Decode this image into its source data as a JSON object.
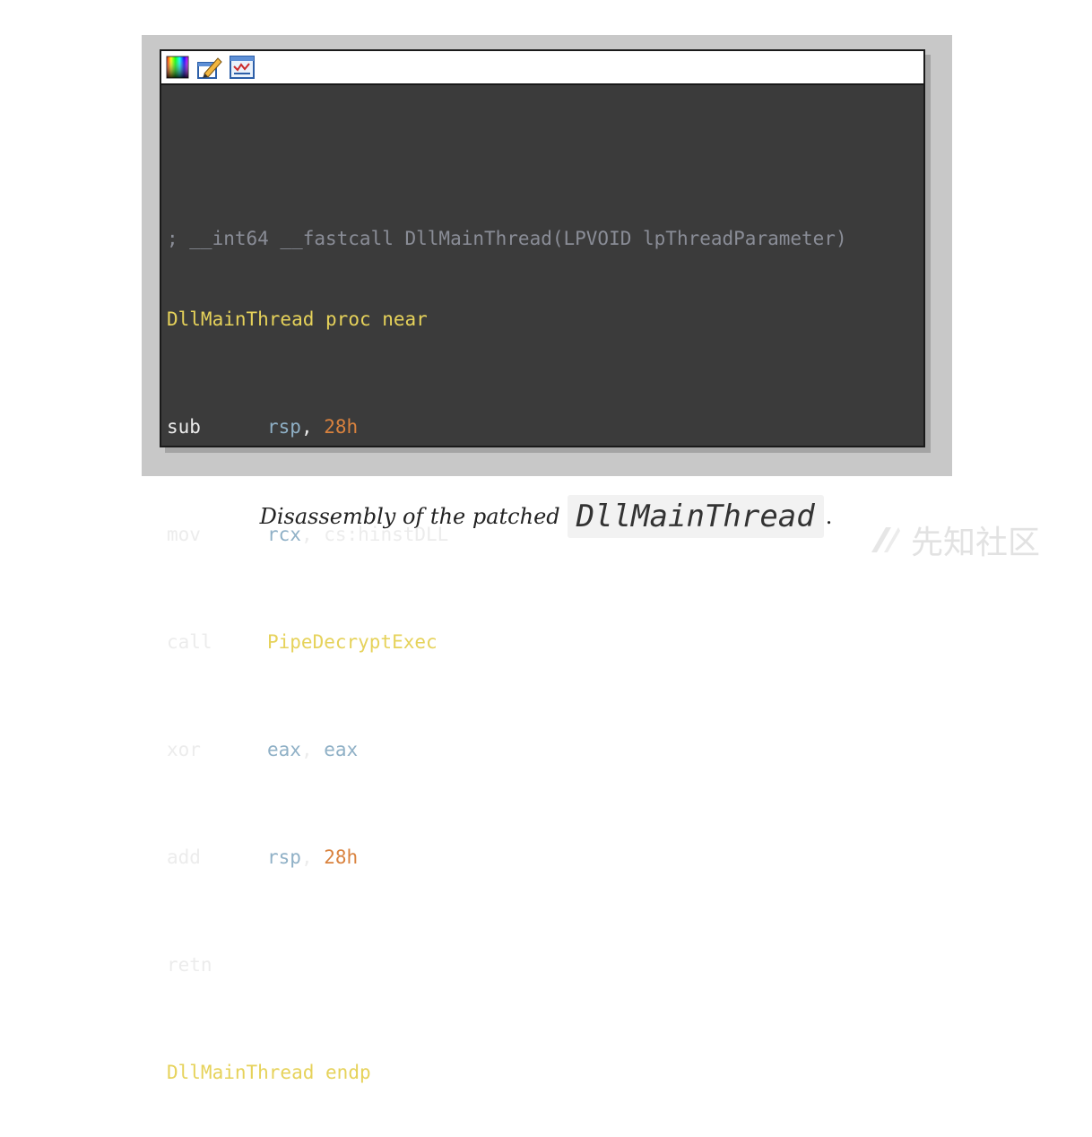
{
  "toolbar": {
    "icons": [
      "color-palette-icon",
      "edit-pen-icon",
      "graph-view-icon"
    ]
  },
  "code": {
    "comment": "; __int64 __fastcall DllMainThread(LPVOID lpThreadParameter)",
    "proc_label": "DllMainThread",
    "proc_kw": "proc near",
    "lines": [
      {
        "mn": "sub",
        "op1": "rsp",
        "sep": ", ",
        "op2": "28h"
      },
      {
        "mn": "mov",
        "op1": "rcx",
        "sep": ", ",
        "op2": "cs:hinstDLL"
      },
      {
        "mn": "call",
        "op1": "PipeDecryptExec"
      },
      {
        "mn": "xor",
        "op1": "eax",
        "sep": ", ",
        "op2": "eax"
      },
      {
        "mn": "add",
        "op1": "rsp",
        "sep": ", ",
        "op2": "28h"
      },
      {
        "mn": "retn"
      }
    ],
    "endp_label": "DllMainThread",
    "endp_kw": "endp"
  },
  "caption": {
    "text": "Disassembly of the patched",
    "code": "DllMainThread",
    "end": "."
  },
  "watermark": {
    "text": "先知社区"
  },
  "colors": {
    "background": "#3b3b3b",
    "label": "#e6d25a",
    "register": "#8fb0c6",
    "number": "#d9823e",
    "comment": "#8a8d97"
  }
}
